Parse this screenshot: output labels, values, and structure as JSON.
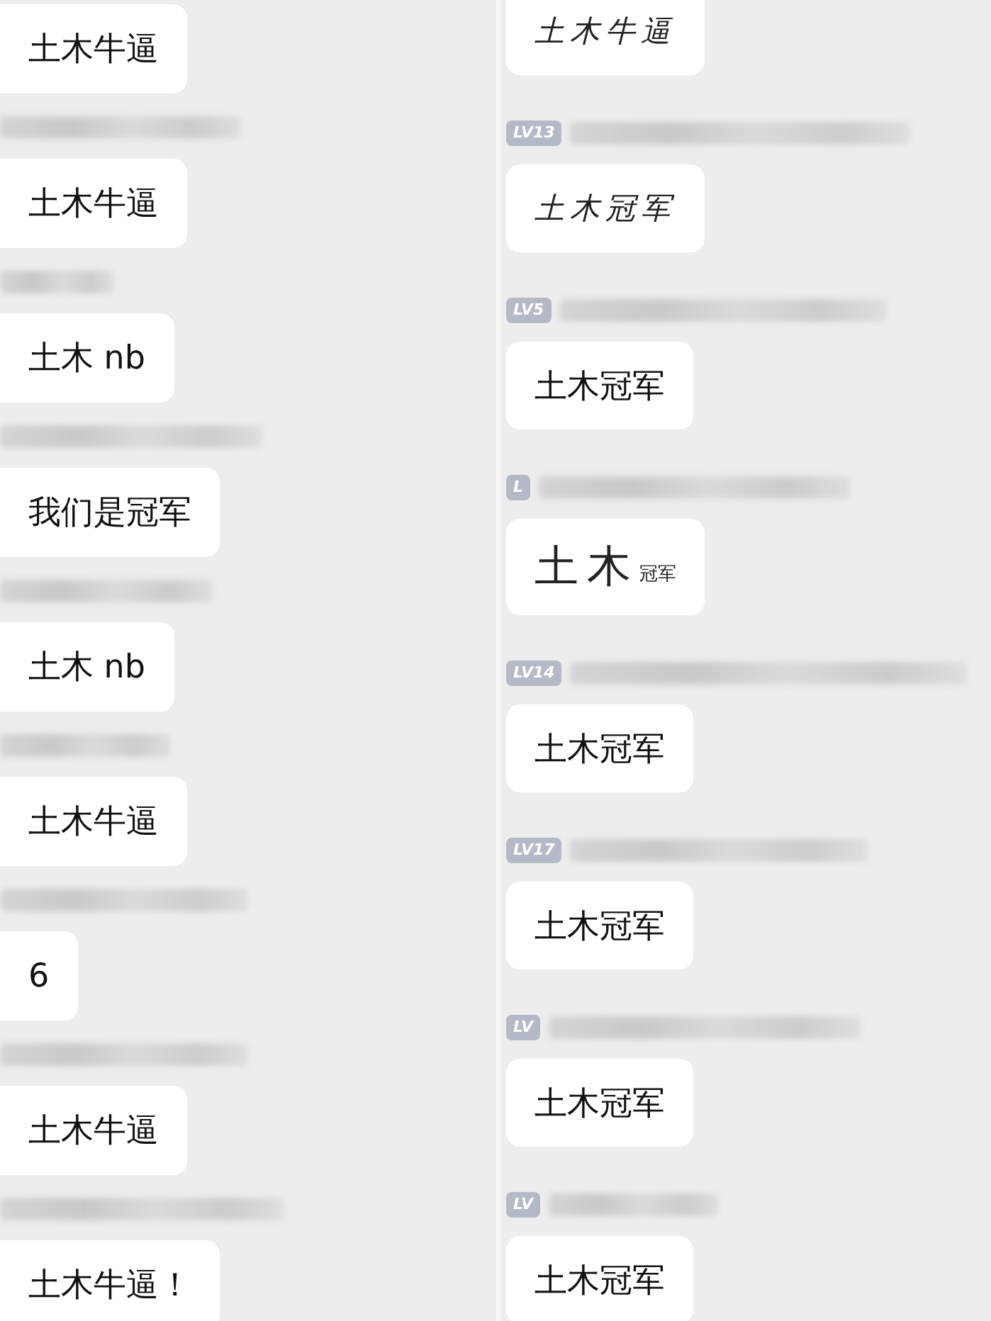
{
  "left_messages": [
    {
      "name_blurred": false,
      "kind": "plain",
      "text": "土木牛逼"
    },
    {
      "name_blurred": true,
      "kind": "plain",
      "text": "土木牛逼"
    },
    {
      "name_blurred": true,
      "kind": "plain",
      "text": "土木 nb"
    },
    {
      "name_blurred": true,
      "kind": "plain",
      "text": "我们是冠军"
    },
    {
      "name_blurred": true,
      "kind": "plain",
      "text": "土木 nb"
    },
    {
      "name_blurred": true,
      "kind": "plain",
      "text": "土木牛逼"
    },
    {
      "name_blurred": true,
      "kind": "plain",
      "text": "6"
    },
    {
      "name_blurred": true,
      "kind": "plain",
      "text": "土木牛逼"
    },
    {
      "name_blurred": true,
      "kind": "plain",
      "text": "土木牛逼！"
    }
  ],
  "right_messages": [
    {
      "name_blurred": false,
      "kind": "script",
      "text": "土木牛逼"
    },
    {
      "badge": "LV13",
      "name_blurred": true,
      "kind": "script",
      "text": "土木冠军"
    },
    {
      "badge": "LV5",
      "name_blurred": true,
      "kind": "plain",
      "text": "土木冠军"
    },
    {
      "badge": "L",
      "name_blurred": true,
      "kind": "mixed",
      "text": "土木",
      "small_text": "冠军"
    },
    {
      "badge": "LV14",
      "name_blurred": true,
      "kind": "plain",
      "text": "土木冠军"
    },
    {
      "badge": "LV17",
      "name_blurred": true,
      "kind": "plain",
      "text": "土木冠军"
    },
    {
      "badge": "LV",
      "name_blurred": true,
      "kind": "plain",
      "text": "土木冠军"
    },
    {
      "badge": "LV",
      "name_blurred": true,
      "kind": "plain",
      "text": "土木冠军"
    }
  ]
}
